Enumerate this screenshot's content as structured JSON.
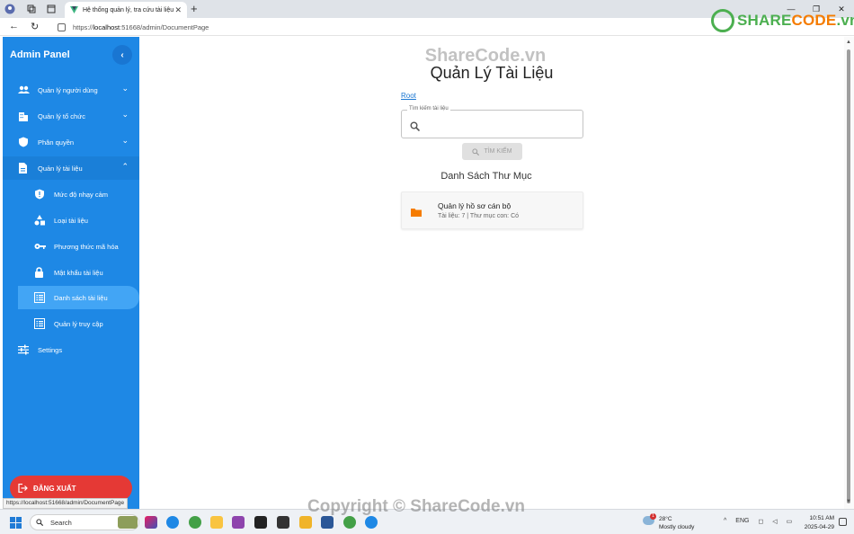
{
  "browser": {
    "tab_title": "Hệ thống quản lý, tra cứu tài liệu",
    "url_prefix": "https://",
    "url_host": "localhost",
    "url_rest": ":51668/admin/DocumentPage",
    "status_url": "https://localhost:51668/admin/DocumentPage"
  },
  "sidebar": {
    "title": "Admin Panel",
    "items": [
      {
        "label": "Quản lý người dùng",
        "icon": "people-icon",
        "expanded": false
      },
      {
        "label": "Quản lý tổ chức",
        "icon": "building-icon",
        "expanded": false
      },
      {
        "label": "Phân quyền",
        "icon": "shield-icon",
        "expanded": false
      },
      {
        "label": "Quản lý tài liệu",
        "icon": "document-icon",
        "expanded": true
      }
    ],
    "sub_items": [
      {
        "label": "Mức độ nhạy cảm",
        "icon": "shield-alert-icon"
      },
      {
        "label": "Loại tài liệu",
        "icon": "shapes-icon"
      },
      {
        "label": "Phương thức mã hóa",
        "icon": "key-icon"
      },
      {
        "label": "Mật khẩu tài liệu",
        "icon": "lock-icon"
      },
      {
        "label": "Danh sách tài liệu",
        "icon": "list-icon",
        "selected": true
      },
      {
        "label": "Quản lý truy cập",
        "icon": "list-icon"
      }
    ],
    "settings_label": "Settings",
    "logout_label": "ĐĂNG XUẤT"
  },
  "main": {
    "title": "Quản Lý Tài Liệu",
    "breadcrumb_root": "Root",
    "search": {
      "legend": "Tìm kiếm tài liệu",
      "value": "",
      "button_label": "TÌM KIẾM"
    },
    "folder_heading": "Danh Sách Thư Mục",
    "folders": [
      {
        "name": "Quản lý hồ sơ cán bộ",
        "meta": "Tài liệu: 7 | Thư mục con: Có"
      }
    ]
  },
  "taskbar": {
    "search_label": "Search",
    "weather_temp": "28°C",
    "weather_desc": "Mostly cloudy",
    "weather_badge": "1",
    "lang": "ENG",
    "time": "10:51 AM",
    "date": "2025-04-29"
  },
  "watermark": {
    "logo_text_share": "SHARE",
    "logo_text_code": "CODE",
    "logo_text_vn": ".vn",
    "top_text": "ShareCode.vn",
    "bottom_text": "Copyright © ShareCode.vn"
  },
  "colors": {
    "sidebar": "#1e88e5",
    "selected_item": "#42a5f5",
    "logout": "#e53935",
    "link": "#1976d2",
    "folder": "#f57c00"
  }
}
